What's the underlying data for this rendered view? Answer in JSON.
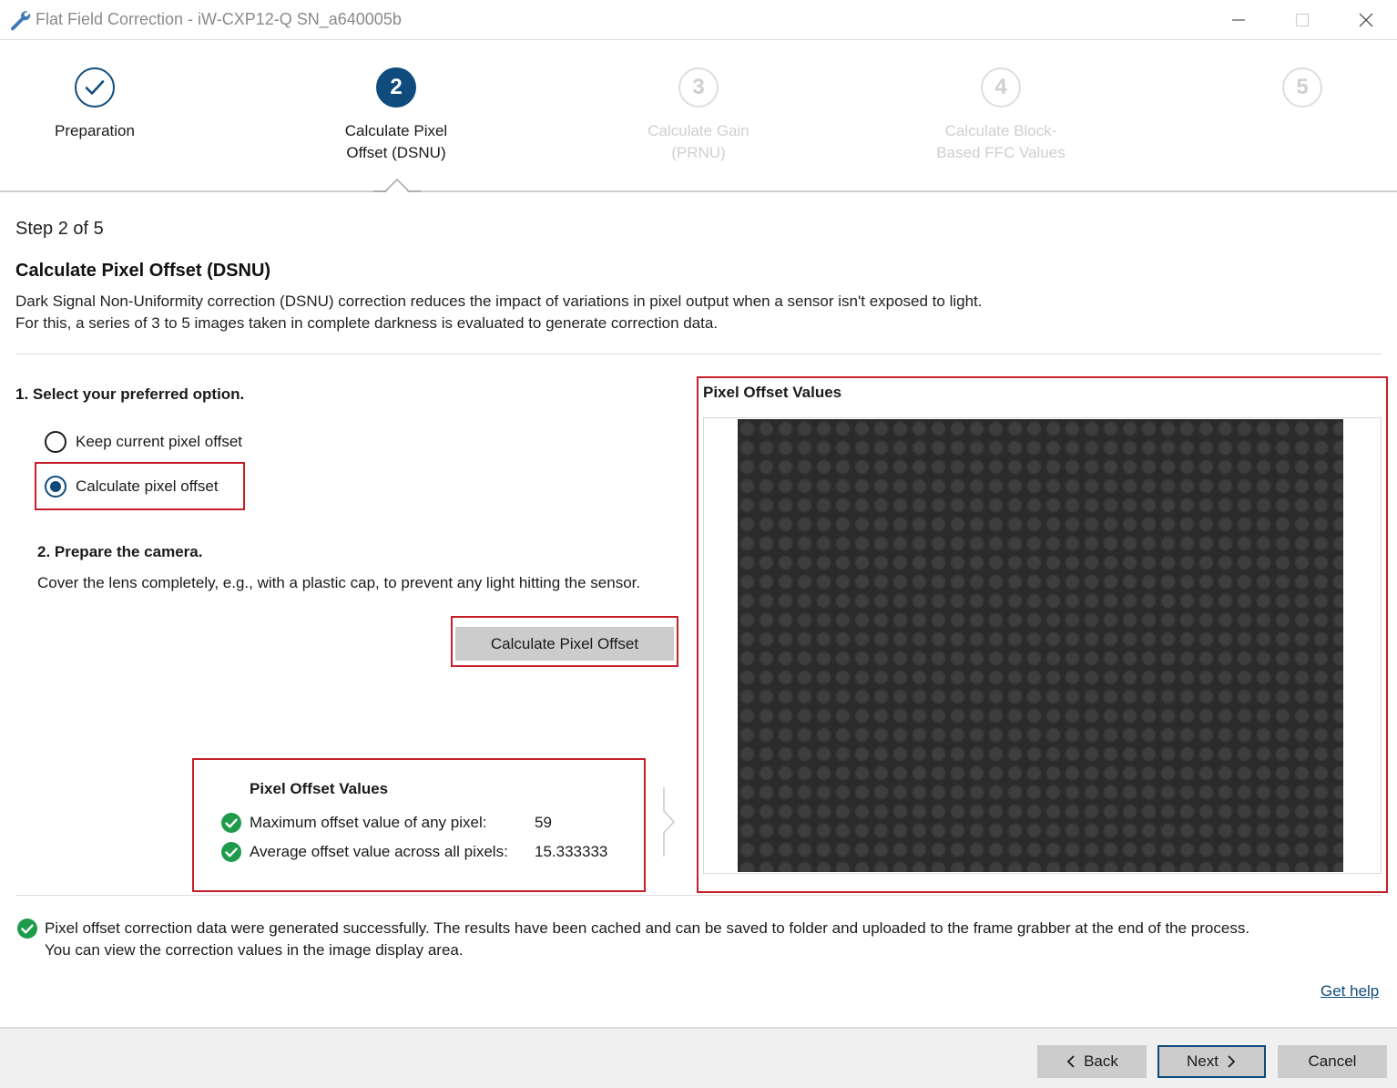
{
  "window": {
    "title": "Flat Field Correction - iW-CXP12-Q SN_a640005b",
    "icon": "wrench-icon",
    "controls": [
      "minimize-icon",
      "maximize-icon",
      "close-icon"
    ]
  },
  "stepper": {
    "steps": [
      {
        "number": "",
        "label": "Preparation",
        "state": "done",
        "icon": "checkmark-icon"
      },
      {
        "number": "2",
        "label": "Calculate Pixel Offset (DSNU)",
        "state": "current"
      },
      {
        "number": "3",
        "label": "Calculate Gain (PRNU)",
        "state": "future"
      },
      {
        "number": "4",
        "label": "Calculate Block-Based FFC Values",
        "state": "future"
      },
      {
        "number": "5",
        "label": "",
        "state": "future"
      }
    ]
  },
  "content": {
    "step_counter": "Step 2 of 5",
    "title": "Calculate Pixel Offset (DSNU)",
    "description_line1": "Dark Signal Non-Uniformity correction (DSNU) correction reduces the impact of variations in pixel output when a sensor isn't exposed to light.",
    "description_line2": "For this, a series of 3 to 5 images taken in complete darkness is evaluated to generate correction data.",
    "section1_heading": "1. Select your preferred option.",
    "options": [
      {
        "label": "Keep current pixel offset",
        "selected": false
      },
      {
        "label": "Calculate pixel offset",
        "selected": true
      }
    ],
    "section2_heading": "2. Prepare the camera.",
    "section2_text": "Cover the lens completely, e.g., with a plastic cap, to prevent any light hitting the sensor.",
    "calculate_button": "Calculate Pixel Offset"
  },
  "summary": {
    "title": "Pixel Offset Values",
    "rows": [
      {
        "label": "Maximum offset value of any pixel:",
        "value": "59"
      },
      {
        "label": "Average offset value across all pixels:",
        "value": "15.333333"
      }
    ]
  },
  "image_panel": {
    "title": "Pixel Offset Values"
  },
  "status": {
    "line1": "Pixel offset correction data were generated successfully. The results have been cached and can be saved to folder and uploaded to the frame grabber at the end of the process.",
    "line2": "You can view the correction values in the image display area."
  },
  "help_link": "Get help",
  "footer": {
    "back": "Back",
    "next": "Next",
    "cancel": "Cancel"
  },
  "colors": {
    "accent": "#0f4c7d",
    "highlight": "#c51f2a",
    "success": "#1e9c4b",
    "inactive": "#cfcfcf"
  }
}
